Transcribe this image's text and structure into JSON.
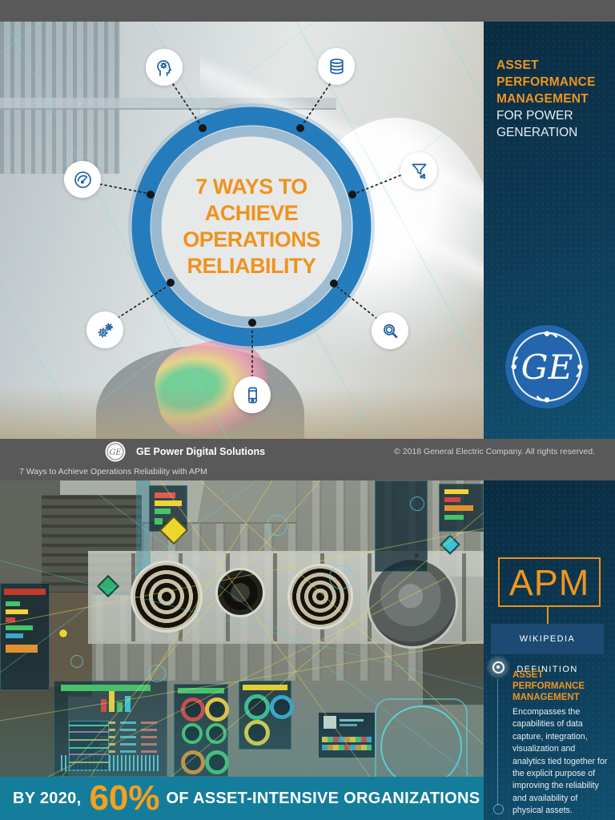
{
  "page1": {
    "diagram": {
      "title_lines": [
        "7 WAYS TO",
        "ACHIEVE",
        "OPERATIONS",
        "RELIABILITY"
      ]
    },
    "icon_names": [
      "mind-gear",
      "database",
      "gauge",
      "funnel",
      "gears",
      "magnifier",
      "mobile-device"
    ],
    "sidebar": {
      "title_orange": [
        "ASSET",
        "PERFORMANCE",
        "MANAGEMENT"
      ],
      "title_white": [
        "FOR POWER",
        "GENERATION"
      ],
      "logo_text": "GE"
    }
  },
  "divider_band": {
    "logo_text": "GE",
    "brand": "GE Power Digital Solutions",
    "copyright": "© 2018 General Electric Company. All rights reserved.",
    "doc_title": "7 Ways to Achieve Operations Reliability with APM"
  },
  "page2": {
    "sidebar": {
      "apm_label": "APM",
      "wiki_button": "WIKIPEDIA DEFINITION",
      "term_lines": [
        "ASSET",
        "PERFORMANCE",
        "MANAGEMENT"
      ],
      "definition": "Encompasses the capabilities of data capture, integration, visualization and analytics tied together for the explicit purpose of improving the reliability and availability of physical assets."
    },
    "statbar": {
      "prefix": "BY 2020,",
      "stat": "60%",
      "suffix": "OF ASSET-INTENSIVE ORGANIZATIONS"
    }
  },
  "colors": {
    "orange": "#f0951f",
    "navy_dark": "#0a2b40",
    "navy_light": "#11506f",
    "ring_blue": "#1d78ba",
    "teal_bar": "#147d9c",
    "wiki_blue": "#1d4a73",
    "viewer_gray": "#59595a"
  }
}
